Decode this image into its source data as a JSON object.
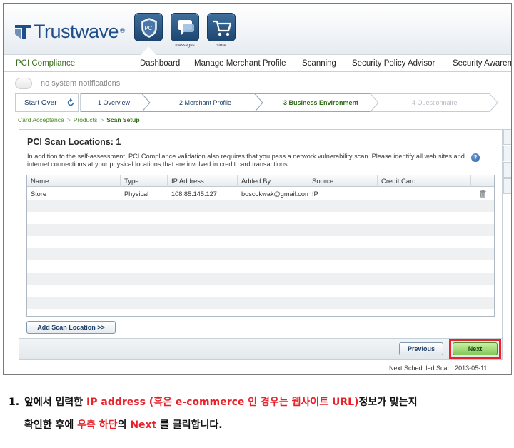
{
  "header": {
    "logo_text": "Trustwave",
    "logo_reg": "®",
    "icons": [
      {
        "name": "pci-shield-icon",
        "label": "",
        "badge": "PCI"
      },
      {
        "name": "messages-icon",
        "label": "messages"
      },
      {
        "name": "store-cart-icon",
        "label": "store"
      }
    ]
  },
  "nav": {
    "brand": "PCI Compliance",
    "items": [
      "Dashboard",
      "Manage Merchant Profile",
      "Scanning",
      "Security Policy Advisor",
      "Security Awarene"
    ]
  },
  "notifications": {
    "text": "no system notifications"
  },
  "wizard": {
    "start_over": "Start Over",
    "steps": [
      {
        "label": "1 Overview",
        "state": "done"
      },
      {
        "label": "2 Merchant Profile",
        "state": "done"
      },
      {
        "label": "3 Business Environment",
        "state": "active"
      },
      {
        "label": "4 Questionnaire",
        "state": "future"
      }
    ]
  },
  "breadcrumb": {
    "items": [
      "Card Acceptance",
      "Products"
    ],
    "current": "Scan Setup",
    "separator": ">"
  },
  "panel": {
    "title": "PCI Scan Locations: 1",
    "description": "In addition to the self-assessment, PCI Compliance validation also requires that you pass a network vulnerability scan.  Please identify all web sites and internet connections at your physical locations that are involved in credit card transactions.",
    "help_glyph": "?",
    "table": {
      "columns": [
        "Name",
        "Type",
        "IP Address",
        "Added By",
        "Source",
        "Credit Card"
      ],
      "rows": [
        {
          "name": "Store",
          "type": "Physical",
          "ip": "108.85.145.127",
          "added_by": "boscokwak@gmail.com",
          "source": "IP",
          "credit_card": ""
        }
      ]
    },
    "add_button": "Add Scan Location >>",
    "previous_button": "Previous",
    "next_button": "Next"
  },
  "footer": {
    "next_scan_label": "Next Scheduled Scan:",
    "next_scan_date": "2013-05-11"
  },
  "instruction": {
    "number": "1.",
    "parts": [
      {
        "text": "앞에서 입력한 ",
        "red": false
      },
      {
        "text": "IP address (혹은 e-commerce 인 경우는 웹사이트 URL)",
        "red": true
      },
      {
        "text": "정보가 맞는지",
        "red": false
      }
    ],
    "line2_parts": [
      {
        "text": "확인한 후에 ",
        "red": false
      },
      {
        "text": "우측 하단",
        "red": true
      },
      {
        "text": "의 ",
        "red": false
      },
      {
        "text": "Next",
        "red": true
      },
      {
        "text": " 를 클릭합니다.",
        "red": false
      }
    ]
  },
  "colors": {
    "brand_blue": "#1f4f8a",
    "green_brand": "#3a6f1c",
    "highlight_red": "#e8212a",
    "next_green": "#86c85a"
  }
}
